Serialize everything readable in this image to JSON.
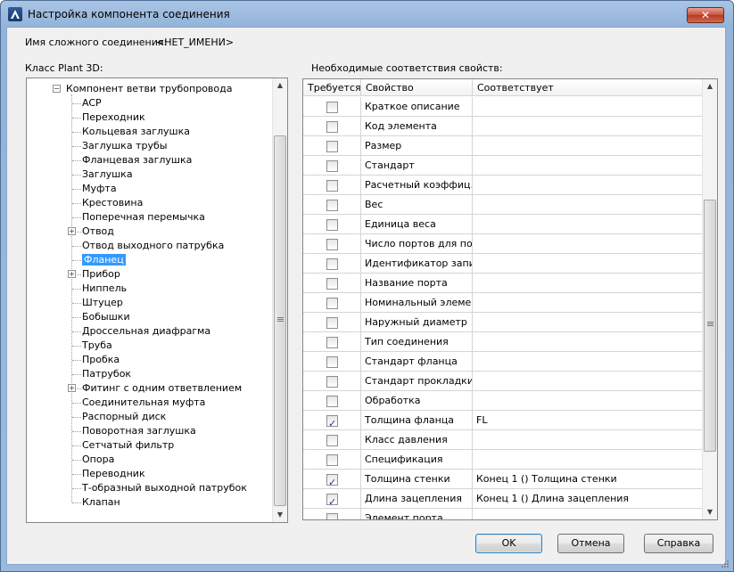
{
  "window": {
    "title": "Настройка компонента соединения",
    "close_label": "✕"
  },
  "labels": {
    "compound_name_label": "Имя сложного соединения:",
    "compound_name_value": "<НЕТ_ИМЕНИ>",
    "class_label": "Класс Plant 3D:",
    "mappings_label": "Необходимые соответствия свойств:"
  },
  "tree": {
    "root": "Компонент ветви трубопровода",
    "items": [
      {
        "label": "ACP",
        "expandable": false
      },
      {
        "label": "Переходник",
        "expandable": false
      },
      {
        "label": "Кольцевая заглушка",
        "expandable": false
      },
      {
        "label": "Заглушка трубы",
        "expandable": false
      },
      {
        "label": "Фланцевая заглушка",
        "expandable": false
      },
      {
        "label": "Заглушка",
        "expandable": false
      },
      {
        "label": "Муфта",
        "expandable": false
      },
      {
        "label": "Крестовина",
        "expandable": false
      },
      {
        "label": "Поперечная перемычка",
        "expandable": false
      },
      {
        "label": "Отвод",
        "expandable": true
      },
      {
        "label": "Отвод выходного патрубка",
        "expandable": false
      },
      {
        "label": "Фланец",
        "expandable": false,
        "selected": true
      },
      {
        "label": "Прибор",
        "expandable": true
      },
      {
        "label": "Ниппель",
        "expandable": false
      },
      {
        "label": "Штуцер",
        "expandable": false
      },
      {
        "label": "Бобышки",
        "expandable": false
      },
      {
        "label": "Дроссельная диафрагма",
        "expandable": false
      },
      {
        "label": "Труба",
        "expandable": false
      },
      {
        "label": "Пробка",
        "expandable": false
      },
      {
        "label": "Патрубок",
        "expandable": false
      },
      {
        "label": "Фитинг с одним ответвлением",
        "expandable": true
      },
      {
        "label": "Соединительная муфта",
        "expandable": false
      },
      {
        "label": "Распорный диск",
        "expandable": false
      },
      {
        "label": "Поворотная заглушка",
        "expandable": false
      },
      {
        "label": "Сетчатый фильтр",
        "expandable": false
      },
      {
        "label": "Опора",
        "expandable": false
      },
      {
        "label": "Переводник",
        "expandable": false
      },
      {
        "label": "Т-образный выходной патрубок",
        "expandable": false
      },
      {
        "label": "Клапан",
        "expandable": false
      }
    ]
  },
  "grid": {
    "headers": [
      "Требуется",
      "Свойство",
      "Соответствует"
    ],
    "rows": [
      {
        "checked": false,
        "property": "Краткое описание",
        "maps": ""
      },
      {
        "checked": false,
        "property": "Код элемента",
        "maps": ""
      },
      {
        "checked": false,
        "property": "Размер",
        "maps": ""
      },
      {
        "checked": false,
        "property": "Стандарт",
        "maps": ""
      },
      {
        "checked": false,
        "property": "Расчетный коэффиц...",
        "maps": ""
      },
      {
        "checked": false,
        "property": "Вес",
        "maps": ""
      },
      {
        "checked": false,
        "property": "Единица веса",
        "maps": ""
      },
      {
        "checked": false,
        "property": "Число портов для по...",
        "maps": ""
      },
      {
        "checked": false,
        "property": "Идентификатор запи...",
        "maps": ""
      },
      {
        "checked": false,
        "property": "Название порта",
        "maps": ""
      },
      {
        "checked": false,
        "property": "Номинальный элеме...",
        "maps": ""
      },
      {
        "checked": false,
        "property": "Наружный диаметр",
        "maps": ""
      },
      {
        "checked": false,
        "property": "Тип соединения",
        "maps": ""
      },
      {
        "checked": false,
        "property": "Стандарт фланца",
        "maps": ""
      },
      {
        "checked": false,
        "property": "Стандарт прокладки",
        "maps": ""
      },
      {
        "checked": false,
        "property": "Обработка",
        "maps": ""
      },
      {
        "checked": true,
        "property": "Толщина фланца",
        "maps": "FL"
      },
      {
        "checked": false,
        "property": "Класс давления",
        "maps": ""
      },
      {
        "checked": false,
        "property": "Спецификация",
        "maps": ""
      },
      {
        "checked": true,
        "property": "Толщина стенки",
        "maps": "Конец 1 () Толщина стенки"
      },
      {
        "checked": true,
        "property": "Длина зацепления",
        "maps": "Конец 1 () Длина зацепления"
      },
      {
        "checked": false,
        "property": "Элемент порта",
        "maps": ""
      }
    ]
  },
  "buttons": {
    "ok": "OK",
    "cancel": "Отмена",
    "help": "Справка"
  }
}
